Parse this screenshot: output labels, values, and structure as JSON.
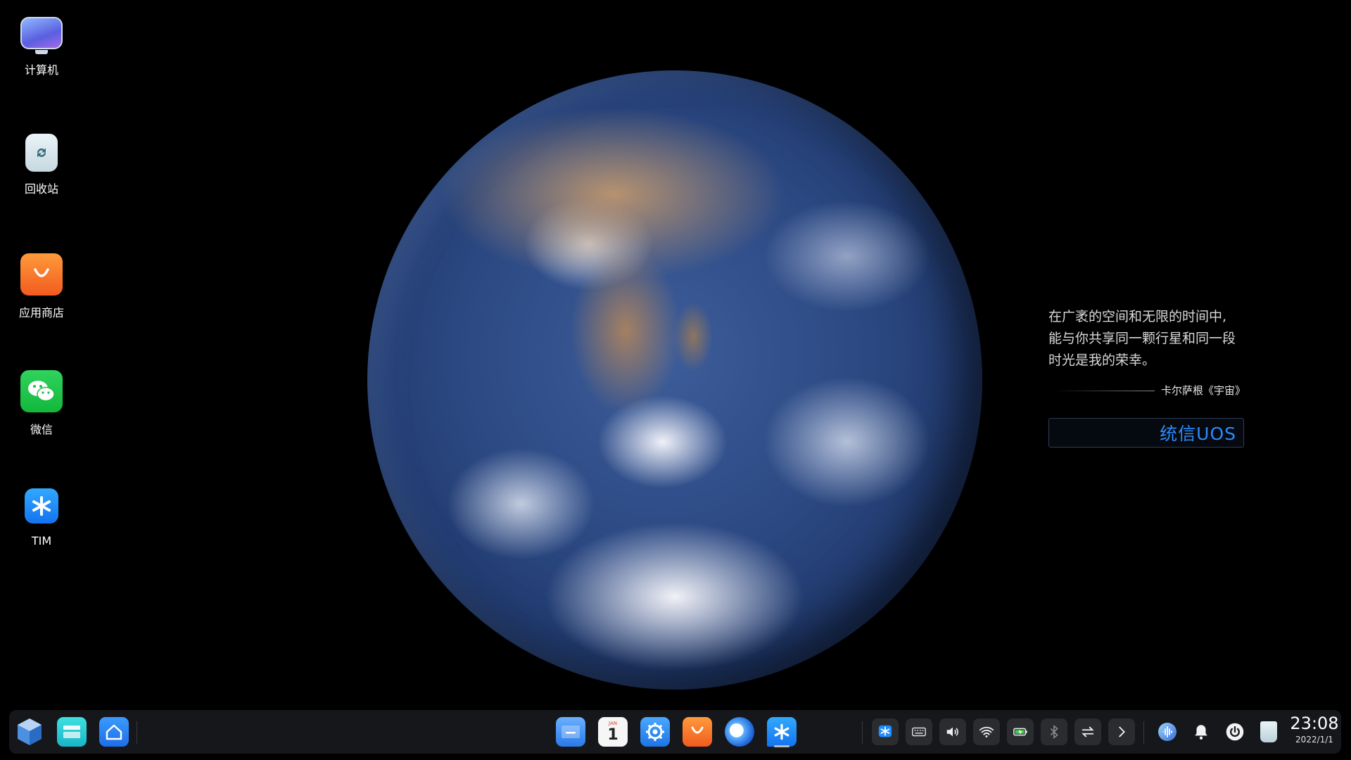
{
  "desktop": {
    "icons": [
      {
        "label": "计算机",
        "icon": "computer-icon"
      },
      {
        "label": "回收站",
        "icon": "trash-icon"
      },
      {
        "label": "应用商店",
        "icon": "app-store-icon"
      },
      {
        "label": "微信",
        "icon": "wechat-icon"
      },
      {
        "label": "TIM",
        "icon": "tim-icon"
      }
    ]
  },
  "wallpaper": {
    "quote_lines": [
      "在广袤的空间和无限的时间中,",
      "能与你共享同一颗行星和同一段",
      "时光是我的荣幸。"
    ],
    "author": "卡尔萨根《宇宙》",
    "brand": "统信UOS"
  },
  "taskbar": {
    "left_apps": [
      "launcher-icon",
      "multitasking-view-icon",
      "show-desktop-icon"
    ],
    "center_apps": [
      "file-manager-icon",
      "calendar-icon",
      "control-center-icon",
      "app-store-icon",
      "browser-icon",
      "tim-icon"
    ],
    "calendar": {
      "month": "JAN",
      "day": "1"
    },
    "tray": [
      "tim-tray-icon",
      "keyboard-icon",
      "volume-icon",
      "wifi-icon",
      "battery-icon",
      "bluetooth-icon",
      "transfer-icon",
      "expand-tray-icon"
    ],
    "plugins": [
      "voice-assistant-icon",
      "notification-bell-icon",
      "power-icon",
      "trash-icon"
    ],
    "clock": {
      "time": "23:08",
      "date": "2022/1/1"
    }
  },
  "colors": {
    "accent": "#2a8bff",
    "taskbar_bg": "#16181c",
    "store_orange": "#f26a23",
    "wechat_green": "#22c44a"
  }
}
